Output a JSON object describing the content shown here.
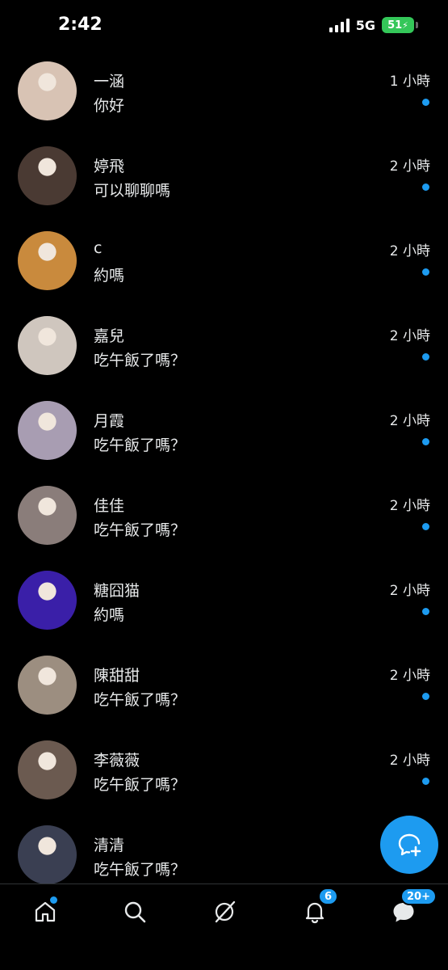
{
  "status_bar": {
    "time": "2:42",
    "network": "5G",
    "battery": "51"
  },
  "conversations": [
    {
      "name": "一涵",
      "message": "你好",
      "time": "1 小時",
      "unread": true,
      "avatar_color": "#d8c3b4"
    },
    {
      "name": "婷飛",
      "message": "可以聊聊嗎",
      "time": "2 小時",
      "unread": true,
      "avatar_color": "#4a3a33"
    },
    {
      "name": "c",
      "message": "約嗎",
      "time": "2 小時",
      "unread": true,
      "avatar_color": "#c98a3d"
    },
    {
      "name": "嘉兒",
      "message": "吃午飯了嗎？",
      "time": "2 小時",
      "unread": true,
      "avatar_color": "#cfc6be"
    },
    {
      "name": "月霞",
      "message": "吃午飯了嗎？",
      "time": "2 小時",
      "unread": true,
      "avatar_color": "#a89db2"
    },
    {
      "name": "佳佳",
      "message": "吃午飯了嗎？",
      "time": "2 小時",
      "unread": true,
      "avatar_color": "#8a7d7a"
    },
    {
      "name": "糖囧猫",
      "message": "約嗎",
      "time": "2 小時",
      "unread": true,
      "avatar_color": "#3a1fa8"
    },
    {
      "name": "陳甜甜",
      "message": "吃午飯了嗎？",
      "time": "2 小時",
      "unread": true,
      "avatar_color": "#9c8e80"
    },
    {
      "name": "李薇薇",
      "message": "吃午飯了嗎？",
      "time": "2 小時",
      "unread": true,
      "avatar_color": "#6b5a50"
    },
    {
      "name": "清清",
      "message": "吃午飯了嗎？",
      "time": "",
      "unread": false,
      "avatar_color": "#3a3f52"
    }
  ],
  "fab": {
    "icon": "new-message-icon"
  },
  "bottom_nav": {
    "items": [
      {
        "icon": "home-icon",
        "has_dot": true
      },
      {
        "icon": "search-icon"
      },
      {
        "icon": "grok-icon"
      },
      {
        "icon": "bell-icon",
        "badge": "6"
      },
      {
        "icon": "messages-icon",
        "badge": "20+"
      }
    ]
  },
  "colors": {
    "accent": "#1d9bf0",
    "background": "#000000",
    "text": "#e7e9ea"
  }
}
